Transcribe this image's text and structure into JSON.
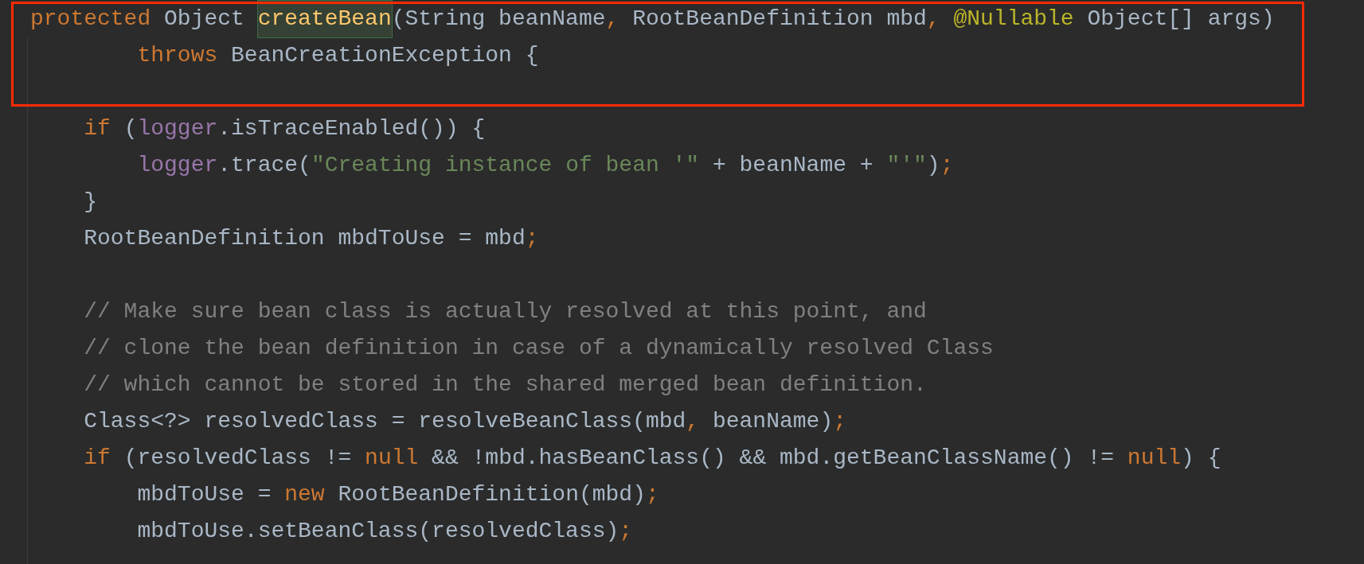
{
  "editor": {
    "lines": [
      {
        "kind": "code",
        "tokens": [
          {
            "text": "protected",
            "kind": "keyword"
          },
          {
            "text": " Object ",
            "kind": "plain"
          },
          {
            "text": "createBean",
            "kind": "declaration",
            "highlighted": true
          },
          {
            "text": "(String beanName",
            "kind": "plain"
          },
          {
            "text": ", ",
            "kind": "punct"
          },
          {
            "text": "RootBeanDefinition mbd",
            "kind": "plain"
          },
          {
            "text": ", ",
            "kind": "punct"
          },
          {
            "text": "@Nullable",
            "kind": "annotation"
          },
          {
            "text": " Object[] args)",
            "kind": "plain"
          }
        ]
      },
      {
        "kind": "code",
        "tokens": [
          {
            "text": "        throws",
            "kind": "keyword"
          },
          {
            "text": " BeanCreationException {",
            "kind": "plain"
          }
        ]
      },
      {
        "kind": "blank"
      },
      {
        "kind": "code",
        "tokens": [
          {
            "text": "    if",
            "kind": "keyword"
          },
          {
            "text": " (",
            "kind": "plain"
          },
          {
            "text": "logger",
            "kind": "field"
          },
          {
            "text": ".isTraceEnabled()) {",
            "kind": "plain"
          }
        ]
      },
      {
        "kind": "code",
        "tokens": [
          {
            "text": "        logger",
            "kind": "field"
          },
          {
            "text": ".trace(",
            "kind": "plain"
          },
          {
            "text": "\"Creating instance of bean '\"",
            "kind": "string"
          },
          {
            "text": " + beanName + ",
            "kind": "plain"
          },
          {
            "text": "\"'\"",
            "kind": "string"
          },
          {
            "text": ")",
            "kind": "plain"
          },
          {
            "text": ";",
            "kind": "punct"
          }
        ]
      },
      {
        "kind": "code",
        "tokens": [
          {
            "text": "    }",
            "kind": "plain"
          }
        ]
      },
      {
        "kind": "code",
        "tokens": [
          {
            "text": "    RootBeanDefinition mbdToUse = mbd",
            "kind": "plain"
          },
          {
            "text": ";",
            "kind": "punct"
          }
        ]
      },
      {
        "kind": "blank"
      },
      {
        "kind": "code",
        "tokens": [
          {
            "text": "    // Make sure bean class is actually resolved at this point, and",
            "kind": "comment"
          }
        ]
      },
      {
        "kind": "code",
        "tokens": [
          {
            "text": "    // clone the bean definition in case of a dynamically resolved Class",
            "kind": "comment"
          }
        ]
      },
      {
        "kind": "code",
        "tokens": [
          {
            "text": "    // which cannot be stored in the shared merged bean definition.",
            "kind": "comment"
          }
        ]
      },
      {
        "kind": "code",
        "tokens": [
          {
            "text": "    Class<?> resolvedClass = resolveBeanClass(mbd",
            "kind": "plain"
          },
          {
            "text": ", ",
            "kind": "punct"
          },
          {
            "text": "beanName)",
            "kind": "plain"
          },
          {
            "text": ";",
            "kind": "punct"
          }
        ]
      },
      {
        "kind": "code",
        "tokens": [
          {
            "text": "    if",
            "kind": "keyword"
          },
          {
            "text": " (resolvedClass != ",
            "kind": "plain"
          },
          {
            "text": "null",
            "kind": "keyword"
          },
          {
            "text": " && !mbd.hasBeanClass() && mbd.getBeanClassName() != ",
            "kind": "plain"
          },
          {
            "text": "null",
            "kind": "keyword"
          },
          {
            "text": ") {",
            "kind": "plain"
          }
        ]
      },
      {
        "kind": "code",
        "tokens": [
          {
            "text": "        mbdToUse = ",
            "kind": "plain"
          },
          {
            "text": "new",
            "kind": "keyword"
          },
          {
            "text": " RootBeanDefinition(mbd)",
            "kind": "plain"
          },
          {
            "text": ";",
            "kind": "punct"
          }
        ]
      },
      {
        "kind": "code",
        "tokens": [
          {
            "text": "        mbdToUse.setBeanClass(resolvedClass)",
            "kind": "plain"
          },
          {
            "text": ";",
            "kind": "punct"
          }
        ]
      }
    ]
  }
}
